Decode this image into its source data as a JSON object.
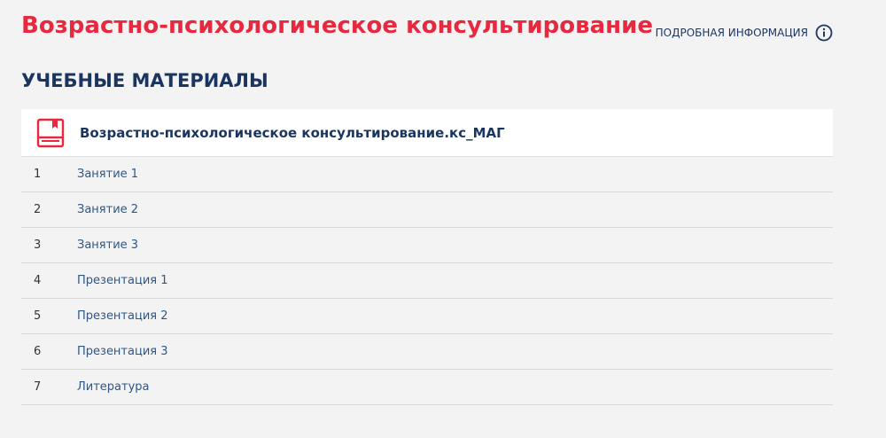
{
  "header": {
    "course_title": "Возрастно-психологическое консультирование",
    "info_link_label": "ПОДРОБНАЯ ИНФОРМАЦИЯ",
    "info_icon": "info-circle-icon"
  },
  "section": {
    "heading": "УЧЕБНЫЕ МАТЕРИАЛЫ"
  },
  "material": {
    "icon": "book-icon",
    "name": "Возрастно-психологическое консультирование.кс_МАГ"
  },
  "lessons": [
    {
      "num": "1",
      "label": "Занятие 1"
    },
    {
      "num": "2",
      "label": "Занятие 2"
    },
    {
      "num": "3",
      "label": "Занятие 3"
    },
    {
      "num": "4",
      "label": "Презентация 1"
    },
    {
      "num": "5",
      "label": "Презентация 2"
    },
    {
      "num": "6",
      "label": "Презентация 3"
    },
    {
      "num": "7",
      "label": "Литература"
    }
  ],
  "colors": {
    "accent_red": "#e8283f",
    "heading_navy": "#1a355f",
    "link_blue": "#2c5788",
    "background": "#f3f3f3"
  }
}
